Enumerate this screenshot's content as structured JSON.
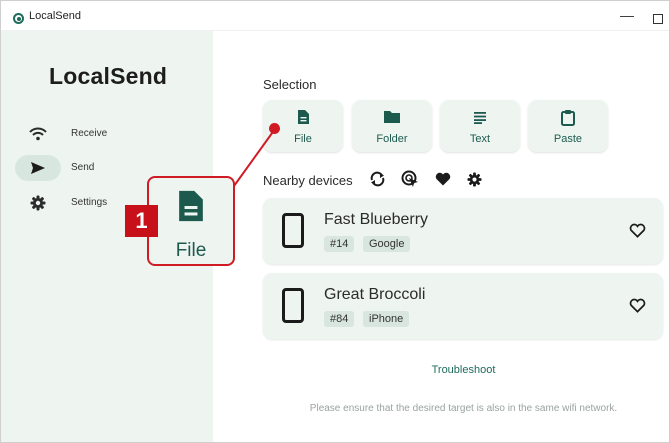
{
  "window": {
    "title": "LocalSend",
    "minimize_glyph": "—",
    "maximize_glyph": ""
  },
  "sidebar": {
    "brand": "LocalSend",
    "items": [
      {
        "label": "Receive",
        "icon": "wifi-icon",
        "active": false
      },
      {
        "label": "Send",
        "icon": "send-icon",
        "active": true
      },
      {
        "label": "Settings",
        "icon": "gear-icon",
        "active": false
      }
    ]
  },
  "selection": {
    "title": "Selection",
    "buttons": [
      {
        "label": "File",
        "icon": "file-icon"
      },
      {
        "label": "Folder",
        "icon": "folder-icon"
      },
      {
        "label": "Text",
        "icon": "text-icon"
      },
      {
        "label": "Paste",
        "icon": "clipboard-icon"
      }
    ]
  },
  "nearby": {
    "title": "Nearby devices",
    "icons": [
      "refresh-icon",
      "scan-icon",
      "favorites-icon",
      "settings-icon"
    ],
    "devices": [
      {
        "name": "Fast Blueberry",
        "tags": [
          "#14",
          "Google"
        ]
      },
      {
        "name": "Great Broccoli",
        "tags": [
          "#84",
          "iPhone"
        ]
      }
    ]
  },
  "troubleshoot": "Troubleshoot",
  "hint": "Please ensure that the desired target is also in the same wifi network.",
  "callout": {
    "number": "1",
    "label": "File"
  },
  "colors": {
    "accent": "#1f6b5c",
    "sidebar_bg": "#eef5f1",
    "callout_red": "#d11b24"
  }
}
